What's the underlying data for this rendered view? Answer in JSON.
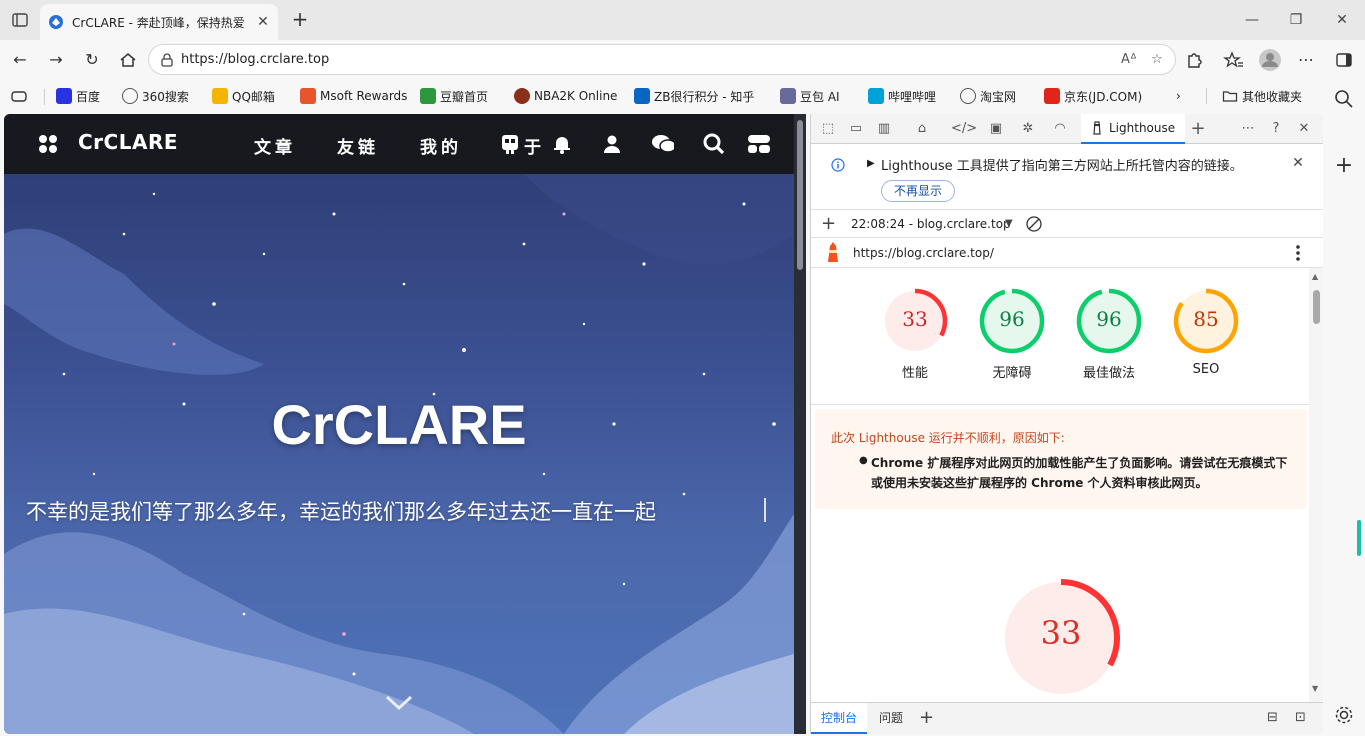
{
  "browser": {
    "tab_title": "CrCLARE - 奔赴顶峰，保持热爱",
    "url": "https://blog.crclare.top",
    "bookmarks": [
      {
        "label": "百度",
        "icon": "baidu-icon",
        "color": "#2932e1"
      },
      {
        "label": "360搜索",
        "icon": "globe-icon",
        "color": "#555555"
      },
      {
        "label": "QQ邮箱",
        "icon": "qqmail-icon",
        "color": "#f4b400"
      },
      {
        "label": "Msoft Rewards",
        "icon": "rewards-icon",
        "color": "#e8542e"
      },
      {
        "label": "豆瓣首页",
        "icon": "douban-icon",
        "color": "#2e963d"
      },
      {
        "label": "NBA2K Online",
        "icon": "basketball-icon",
        "color": "#8b2e1a"
      },
      {
        "label": "ZB很行积分 - 知乎",
        "icon": "zhihu-icon",
        "color": "#0a66c2"
      },
      {
        "label": "豆包 AI",
        "icon": "doubao-icon",
        "color": "#6a6a9a"
      },
      {
        "label": "哔哩哔哩",
        "icon": "bilibili-icon",
        "color": "#00a1d6"
      },
      {
        "label": "淘宝网",
        "icon": "globe-icon",
        "color": "#555555"
      },
      {
        "label": "京东(JD.COM)",
        "icon": "jd-icon",
        "color": "#e1251b"
      }
    ],
    "other_bookmarks": "其他收藏夹"
  },
  "site": {
    "logo": "CrCLARE",
    "nav": [
      "文章",
      "友链",
      "我的"
    ],
    "nav_extra": "于",
    "hero_title": "CrCLARE",
    "hero_subtitle": "不幸的是我们等了那么多年，幸运的我们那么多年过去还一直在一起"
  },
  "devtools": {
    "active_tab": "Lighthouse",
    "info_text": "Lighthouse 工具提供了指向第三方网站上所托管内容的链接。",
    "info_dismiss": "不再显示",
    "report_time": "22:08:24 - blog.crclare.top",
    "report_url": "https://blog.crclare.top/",
    "scores": [
      {
        "label": "性能",
        "value": "33",
        "score": 33,
        "color": "#ff3333",
        "bg": "#fdecea",
        "text_color": "#c62828"
      },
      {
        "label": "无障碍",
        "value": "96",
        "score": 96,
        "color": "#0cce6b",
        "bg": "#e6f8ee",
        "text_color": "#0b8043"
      },
      {
        "label": "最佳做法",
        "value": "96",
        "score": 96,
        "color": "#0cce6b",
        "bg": "#e6f8ee",
        "text_color": "#0b8043"
      },
      {
        "label": "SEO",
        "value": "85",
        "score": 85,
        "color": "#ffa400",
        "bg": "#fff3e0",
        "text_color": "#c33300"
      }
    ],
    "warning_title": "此次 Lighthouse 运行并不顺利，原因如下:",
    "warning_item": "Chrome 扩展程序对此网页的加载性能产生了负面影响。请尝试在无痕模式下或使用未安装这些扩展程序的 Chrome 个人资料审核此网页。",
    "big_score": {
      "value": "33",
      "score": 33,
      "color": "#ff3333"
    },
    "drawer": {
      "console": "控制台",
      "issues": "问题"
    }
  }
}
